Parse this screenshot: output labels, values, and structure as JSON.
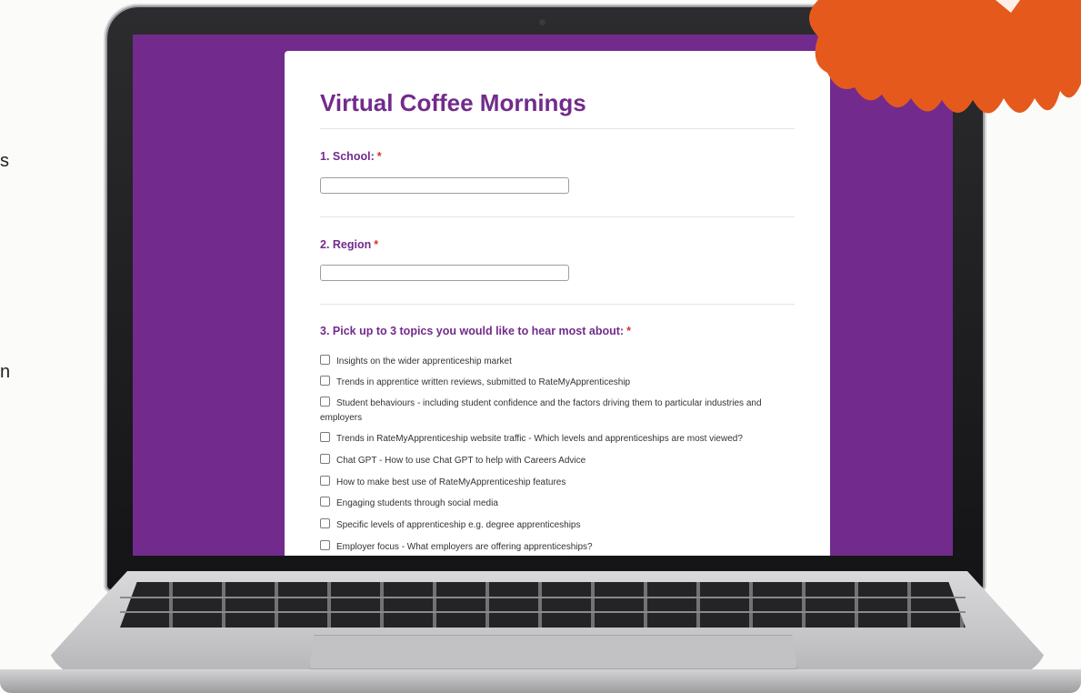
{
  "page": {
    "side_fragments": [
      "s",
      "n"
    ]
  },
  "form": {
    "title": "Virtual Coffee Mornings",
    "required_mark": "*",
    "questions": [
      {
        "label": "1. School:",
        "type": "text",
        "value": ""
      },
      {
        "label": "2. Region",
        "type": "text",
        "value": ""
      },
      {
        "label": "3. Pick up to 3 topics you would like to hear most about:",
        "type": "checkbox",
        "options": [
          "Insights on the wider apprenticeship market",
          "Trends in apprentice written reviews, submitted to RateMyApprenticeship",
          "Student behaviours - including student confidence and the factors driving them to particular industries and employers",
          "Trends in RateMyApprenticeship website traffic - Which levels and apprenticeships are most viewed?",
          "Chat GPT - How to use Chat GPT to help with Careers Advice",
          "How to make best use of RateMyApprenticeship features",
          "Engaging students through social media",
          "Specific levels of apprenticeship e.g. degree apprenticeships",
          "Employer focus - What employers are offering apprenticeships?"
        ]
      }
    ]
  },
  "colors": {
    "brand_purple": "#722b8c",
    "required_red": "#d93025",
    "accent_orange": "#e55a1c"
  }
}
